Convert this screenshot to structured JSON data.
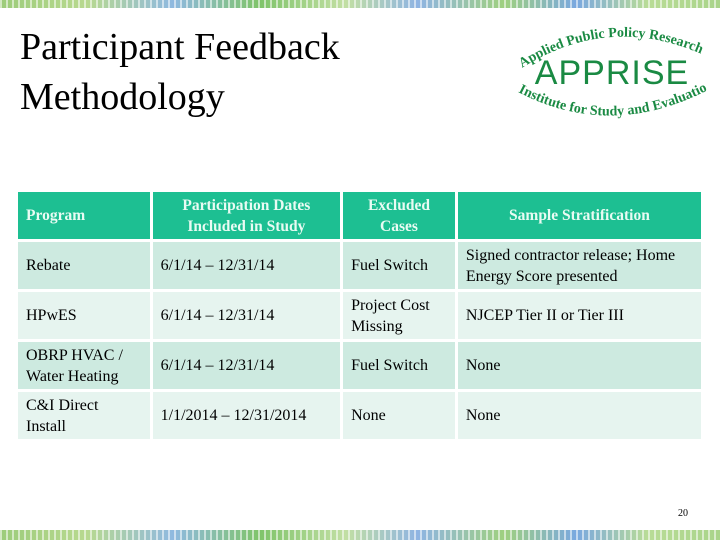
{
  "slide": {
    "title_line1": "Participant Feedback",
    "title_line2": "Methodology",
    "page_number": "20"
  },
  "logo": {
    "top_arc": "Applied Public Policy Research",
    "name": "APPRISE",
    "bottom_arc": "Institute for Study and Evaluation",
    "color": "#1a8a43"
  },
  "table": {
    "headers": [
      "Program",
      "Participation Dates Included in Study",
      "Excluded Cases",
      "Sample Stratification"
    ],
    "rows": [
      [
        "Rebate",
        "6/1/14 – 12/31/14",
        "Fuel Switch",
        "Signed contractor release; Home Energy Score presented"
      ],
      [
        "HPwES",
        "6/1/14 – 12/31/14",
        "Project Cost Missing",
        "NJCEP Tier II or Tier III"
      ],
      [
        "OBRP HVAC / Water Heating",
        "6/1/14 – 12/31/14",
        "Fuel Switch",
        "None"
      ],
      [
        "C&I Direct Install",
        "1/1/2014 – 12/31/2014",
        "None",
        "None"
      ]
    ],
    "colors": {
      "header_bg": "#1dbf92",
      "row_odd_bg": "#cdeae0",
      "row_even_bg": "#e6f4ef"
    }
  }
}
